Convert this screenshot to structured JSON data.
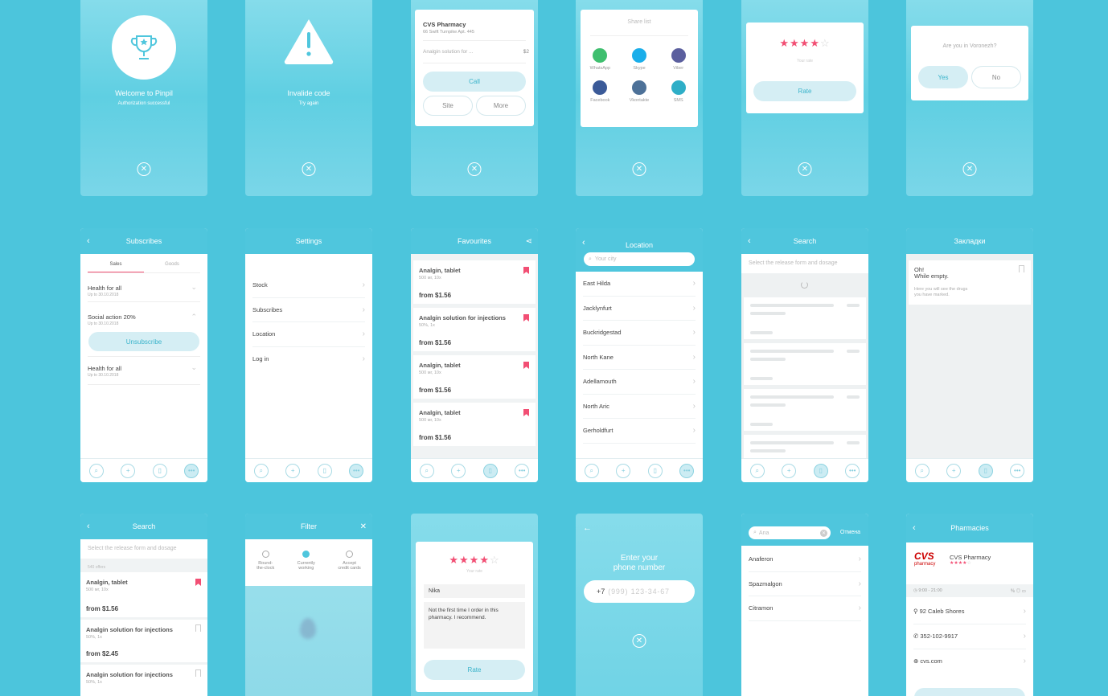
{
  "welcome": {
    "title": "Welcome to Pinpil",
    "subtitle": "Authorization successful"
  },
  "invalid": {
    "title": "Invalide code",
    "subtitle": "Try again"
  },
  "pharmacy_popup": {
    "name": "CVS Pharmacy",
    "address": "66 Swift Turnpike Apt. 445",
    "item": "Analgin solution for ...",
    "price": "$2",
    "call": "Call",
    "site": "Site",
    "more": "More"
  },
  "share": {
    "title": "Share list",
    "apps": [
      {
        "label": "WhatsApp",
        "icon": "whatsapp-icon",
        "color": "#3fbf6f"
      },
      {
        "label": "Skype",
        "icon": "skype-icon",
        "color": "#1aaeea"
      },
      {
        "label": "Viber",
        "icon": "viber-icon",
        "color": "#5b5f9e"
      },
      {
        "label": "Facebook",
        "icon": "facebook-icon",
        "color": "#3b5a98"
      },
      {
        "label": "Vkontakte",
        "icon": "vk-icon",
        "color": "#4d7198"
      },
      {
        "label": "SMS",
        "icon": "sms-icon",
        "color": "#2eaec7"
      }
    ]
  },
  "rate_popup": {
    "stars_filled": 4,
    "stars_total": 5,
    "caption": "Your rate",
    "button": "Rate"
  },
  "city_popup": {
    "question": "Are you in Voronezh?",
    "yes": "Yes",
    "no": "No"
  },
  "subscribes": {
    "title": "Subscribes",
    "tabs": [
      "Sales",
      "Goods"
    ],
    "items": [
      {
        "title": "Health for all",
        "date": "Up to 30.10.2018"
      },
      {
        "title": "Social action 20%",
        "date": "Up to 30.10.2018"
      },
      {
        "title": "Health for all",
        "date": "Up to 30.10.2018"
      }
    ],
    "unsubscribe": "Unsubscribe"
  },
  "settings": {
    "title": "Settings",
    "items": [
      "Stock",
      "Subscribes",
      "Location",
      "Log in"
    ]
  },
  "favourites": {
    "title": "Favourites",
    "items": [
      {
        "name": "Analgin, tablet",
        "dose": "500 мг, 10х",
        "price": "from $1.56"
      },
      {
        "name": "Analgin solution for injections",
        "dose": "50%, 1х",
        "price": "from $1.56"
      },
      {
        "name": "Analgin, tablet",
        "dose": "500 мг, 10х",
        "price": "from $1.56"
      },
      {
        "name": "Analgin, tablet",
        "dose": "500 мг, 10х",
        "price": "from $1.56"
      }
    ]
  },
  "location": {
    "title": "Location",
    "placeholder": "Your city",
    "cities": [
      "East Hilda",
      "Jacklynfurt",
      "Buckridgestad",
      "North Kane",
      "Adellamouth",
      "North Aric",
      "Gerholdfurt"
    ]
  },
  "search_loading": {
    "title": "Search",
    "placeholder": "Select the release form and dosage"
  },
  "bookmarks": {
    "title": "Закладки",
    "empty_title": "Oh!",
    "empty_title2": "While empty.",
    "empty_text": "Here you will see the drugs",
    "empty_text2": "you have marked."
  },
  "search_results": {
    "title": "Search",
    "placeholder": "Select the release form and dosage",
    "count": "540 offers",
    "items": [
      {
        "name": "Analgin, tablet",
        "dose": "500 мг, 10х",
        "price": "from $1.56",
        "marked": true
      },
      {
        "name": "Analgin solution for injections",
        "dose": "50%, 1х",
        "price": "from $2.45",
        "marked": false
      },
      {
        "name": "Analgin solution for injections",
        "dose": "50%, 1х",
        "price": "",
        "marked": false
      }
    ]
  },
  "filter": {
    "title": "Filter",
    "options": [
      {
        "label": "Round-",
        "label2": "the-clock",
        "checked": false
      },
      {
        "label": "Currently",
        "label2": "working",
        "checked": true
      },
      {
        "label": "Accept",
        "label2": "credit cards",
        "checked": false
      }
    ]
  },
  "review": {
    "caption": "Your rate",
    "name": "Nika",
    "text": "Not the first time I order in this pharmacy. I recommend.",
    "button": "Rate",
    "stars_filled": 4
  },
  "phone": {
    "title": "Enter your",
    "title2": "phone number",
    "prefix": "+7",
    "placeholder": "(999) 123-34-67"
  },
  "drug_search": {
    "query": "Ana",
    "cancel": "Отмена",
    "results": [
      "Anaferon",
      "Spazmalgon",
      "Citramon"
    ]
  },
  "pharmacies": {
    "title": "Pharmacies",
    "logo": "CVS",
    "logo_sub": "pharmacy",
    "name": "CVS Pharmacy",
    "hours": "9:00 - 21:00",
    "address": "92 Caleb Shores",
    "phone": "352-102-9917",
    "site": "cvs.com",
    "brand_color": "#cc0000"
  },
  "colors": {
    "accent": "#4fc6dd",
    "background": "#4cc5dc",
    "star": "#f24f74"
  }
}
